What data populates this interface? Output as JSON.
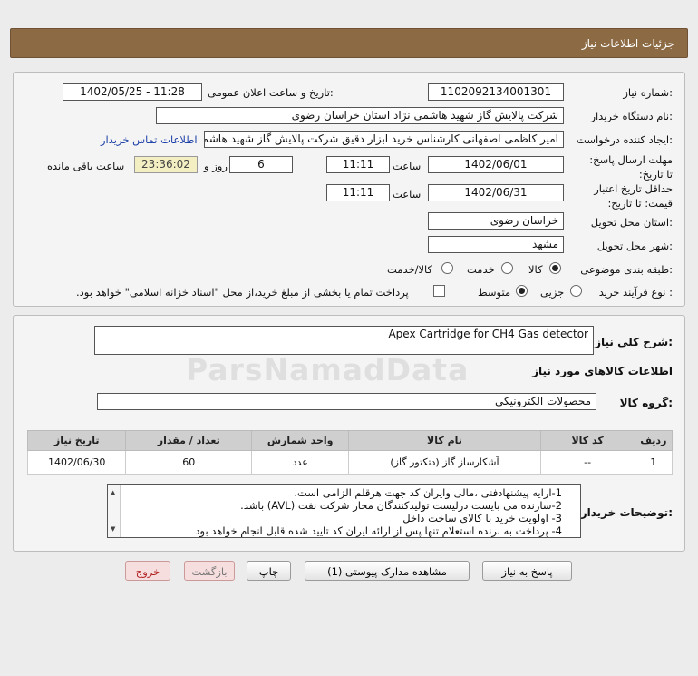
{
  "header": {
    "title": "جزئیات اطلاعات نیاز"
  },
  "form": {
    "need_number_label": "شماره نیاز:",
    "need_number": "1102092134001301",
    "announce_label": "تاریخ و ساعت اعلان عمومی:",
    "announce_value": "1402/05/25 - 11:28",
    "buyer_org_label": "نام دستگاه خریدار:",
    "buyer_org": "شرکت پالایش گاز شهید هاشمی نژاد   استان خراسان رضوی",
    "creator_label": "ایجاد کننده درخواست:",
    "creator": "امیر کاظمی اصفهانی کارشناس خرید ابزار دقیق شرکت پالایش گاز شهید هاشمی نژاد",
    "contact_link": "اطلاعات تماس خریدار",
    "reply_deadline_label": "مهلت ارسال پاسخ: تا تاریخ:",
    "reply_date": "1402/06/01",
    "time_label": "ساعت",
    "reply_time": "11:11",
    "days": "6",
    "days_label": "روز و",
    "remaining": "23:36:02",
    "remaining_label": "ساعت باقی مانده",
    "validity_label": "حداقل تاریخ اعتبار قیمت: تا تاریخ:",
    "validity_date": "1402/06/31",
    "validity_time": "11:11",
    "province_label": "استان محل تحویل:",
    "province": "خراسان رضوی",
    "city_label": "شهر محل تحویل:",
    "city": "مشهد",
    "category_label": "طبقه بندی موضوعی:",
    "category_options": [
      "کالا",
      "خدمت",
      "کالا/خدمت"
    ],
    "process_label": "نوع فرآیند خرید :",
    "process_options": [
      "جزیی",
      "متوسط"
    ],
    "payment_note": "پرداخت تمام یا بخشی از مبلغ خرید،از محل \"اسناد خزانه اسلامی\" خواهد بود."
  },
  "need": {
    "summary_label": "شرح کلی نیاز:",
    "summary": "Apex Cartridge for CH4 Gas detector",
    "goods_info_title": "اطلاعات کالاهای مورد نیاز",
    "goods_group_label": "گروه کالا:",
    "goods_group": "محصولات الکترونیکی"
  },
  "table": {
    "headers": [
      "ردیف",
      "کد کالا",
      "نام کالا",
      "واحد شمارش",
      "تعداد / مقدار",
      "تاریخ نیاز"
    ],
    "rows": [
      [
        "1",
        "--",
        "آشکارساز گاز (دتکتور گاز)",
        "عدد",
        "60",
        "1402/06/30"
      ]
    ]
  },
  "notes": {
    "label": "توضیحات خریدار:",
    "lines": [
      "1-ارایه پیشنهادفنی ،مالی وایران کد جهت هرقلم الزامی است.",
      "2-سازنده می بایست درلیست تولیدکنندگان مجاز شرکت نفت (AVL)  باشد.",
      "3- اولویت خرید با کالای ساخت داخل",
      "4- پرداخت به برنده استعلام تنها پس از ارائه ایران کد تایید شده قابل انجام خواهد بود"
    ]
  },
  "buttons": {
    "reply": "پاسخ به نیاز",
    "attachments": "مشاهده مدارک پیوستی (1)",
    "print": "چاپ",
    "back": "بازگشت",
    "exit": "خروج"
  },
  "watermark": "ParsNamadData"
}
